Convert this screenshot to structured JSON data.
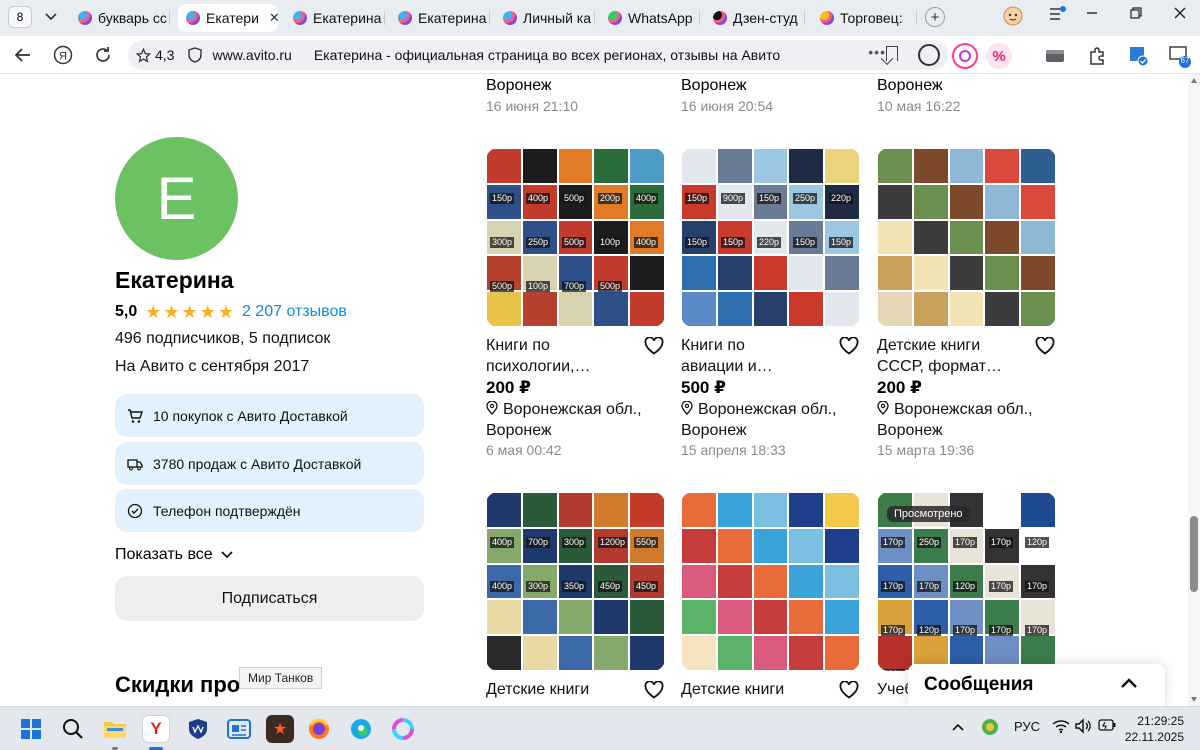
{
  "browser": {
    "tab_count": "8",
    "tabs": [
      {
        "label": "букварь сс",
        "fav": "#3db4f0"
      },
      {
        "label": "Екатери",
        "fav": "#3db4f0",
        "active": true
      },
      {
        "label": "Екатерина",
        "fav": "#3db4f0"
      },
      {
        "label": "Екатерина",
        "fav": "#3db4f0"
      },
      {
        "label": "Личный ка",
        "fav": "#3db4f0"
      },
      {
        "label": "WhatsApp",
        "fav": "#25d366"
      },
      {
        "label": "Дзен-студ",
        "fav": "#111111"
      },
      {
        "label": "Торговец:",
        "fav": "#f2c01c"
      }
    ],
    "site_rating": "4,3",
    "domain": "www.avito.ru",
    "page_title": "Екатерина - официальная страница во всех регионах, отзывы на Авито",
    "ext_badge": "67"
  },
  "profile": {
    "avatar_letter": "Е",
    "name": "Екатерина",
    "rating": "5,0",
    "reviews": "2 207 отзывов",
    "followers": "496 подписчиков, 5 подписок",
    "since": "На Авито с сентября 2017",
    "badges": [
      "10 покупок с Авито Доставкой",
      "3780 продаж с Авито Доставкой",
      "Телефон подтверждён"
    ],
    "show_all": "Показать все",
    "subscribe": "Подписаться",
    "discounts": "Скидки про",
    "tooltip": "Мир Танков"
  },
  "listings_top": [
    {
      "city": "Воронеж",
      "date": "16 июня 21:10"
    },
    {
      "city": "Воронеж",
      "date": "16 июня 20:54"
    },
    {
      "city": "Воронеж",
      "date": "10 мая 16:22"
    }
  ],
  "listings": [
    {
      "title1": "Книги по",
      "title2": "психологии,…",
      "price": "200 ₽",
      "loc1": "Воронежская обл.,",
      "loc2": "Воронеж",
      "date": "6 мая 00:42",
      "tags": [
        "150р",
        "400р",
        "500р",
        "200р",
        "400р",
        "300р",
        "250р",
        "500р",
        "100р",
        "400р",
        "500р",
        "100р",
        "700р",
        "500р"
      ]
    },
    {
      "title1": "Книги по",
      "title2": "авиации и…",
      "price": "500 ₽",
      "loc1": "Воронежская обл.,",
      "loc2": "Воронеж",
      "date": "15 апреля 18:33",
      "tags": [
        "150р",
        "900р",
        "150р",
        "250р",
        "220р",
        "150р",
        "150р",
        "220р",
        "150р",
        "150р"
      ]
    },
    {
      "title1": "Детские книги",
      "title2": "СССР, формат…",
      "price": "200 ₽",
      "loc1": "Воронежская обл.,",
      "loc2": "Воронеж",
      "date": "15 марта 19:36",
      "tags": []
    },
    {
      "title1": "Детские книги",
      "title2": "",
      "price": "",
      "loc1": "",
      "loc2": "",
      "date": "",
      "tags": [
        "400р",
        "700р",
        "300р",
        "1200р",
        "550р",
        "400р",
        "300р",
        "350р",
        "450р",
        "450р"
      ]
    },
    {
      "title1": "Детские книги",
      "title2": "",
      "price": "",
      "loc1": "",
      "loc2": "",
      "date": "",
      "tags": []
    },
    {
      "title1": "Учеб",
      "title2": "",
      "price": "",
      "loc1": "",
      "loc2": "",
      "date": "",
      "viewed": "Просмотрено",
      "tags": [
        "170р",
        "250р",
        "170р",
        "170р",
        "120р",
        "170р",
        "170р",
        "120р",
        "170р",
        "170р",
        "170р",
        "120р",
        "170р",
        "170р",
        "170р",
        "120р"
      ]
    }
  ],
  "messages": {
    "label": "Сообщения"
  },
  "taskbar": {
    "lang": "РУС",
    "time": "21:29:25",
    "date": "22.11.2025"
  },
  "colors": {
    "accent_link": "#0a8fe5",
    "avatar": "#6cc163",
    "badge_bg": "#e2f1fc",
    "star": "#ffb021"
  }
}
